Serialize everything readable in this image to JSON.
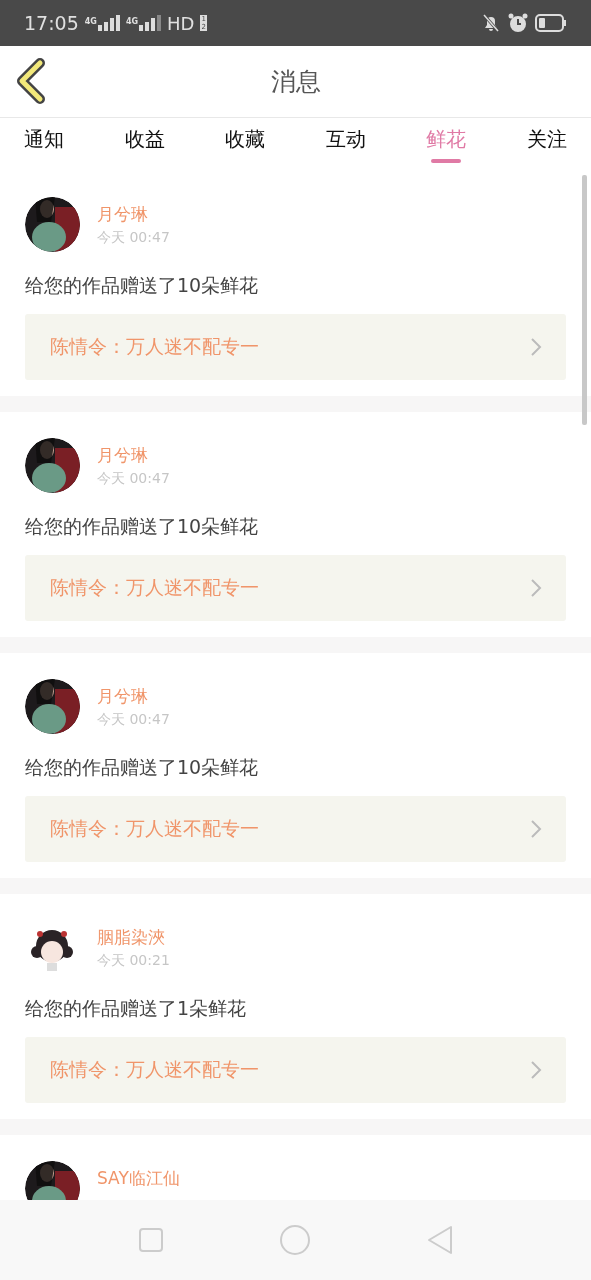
{
  "status_bar": {
    "time": "17:05",
    "sim_labels": [
      "4G",
      "4G"
    ],
    "hd": "HD",
    "hd_slots": [
      "1",
      "2"
    ]
  },
  "header": {
    "title": "消息"
  },
  "tabs": [
    {
      "label": "通知",
      "selected": false
    },
    {
      "label": "收益",
      "selected": false
    },
    {
      "label": "收藏",
      "selected": false
    },
    {
      "label": "互动",
      "selected": false
    },
    {
      "label": "鲜花",
      "selected": true
    },
    {
      "label": "关注",
      "selected": false
    }
  ],
  "messages": [
    {
      "user": "月兮琳",
      "time": "今天 00:47",
      "text": "给您的作品赠送了10朵鲜花",
      "work": "陈情令：万人迷不配专一"
    },
    {
      "user": "月兮琳",
      "time": "今天 00:47",
      "text": "给您的作品赠送了10朵鲜花",
      "work": "陈情令：万人迷不配专一"
    },
    {
      "user": "月兮琳",
      "time": "今天 00:47",
      "text": "给您的作品赠送了10朵鲜花",
      "work": "陈情令：万人迷不配专一"
    },
    {
      "user": "胭脂染浹",
      "time": "今天 00:21",
      "avatar": {
        "kind": "cartoon"
      },
      "text": "给您的作品赠送了1朵鲜花",
      "work": "陈情令：万人迷不配专一"
    },
    {
      "user": "SAY临江仙"
    }
  ]
}
